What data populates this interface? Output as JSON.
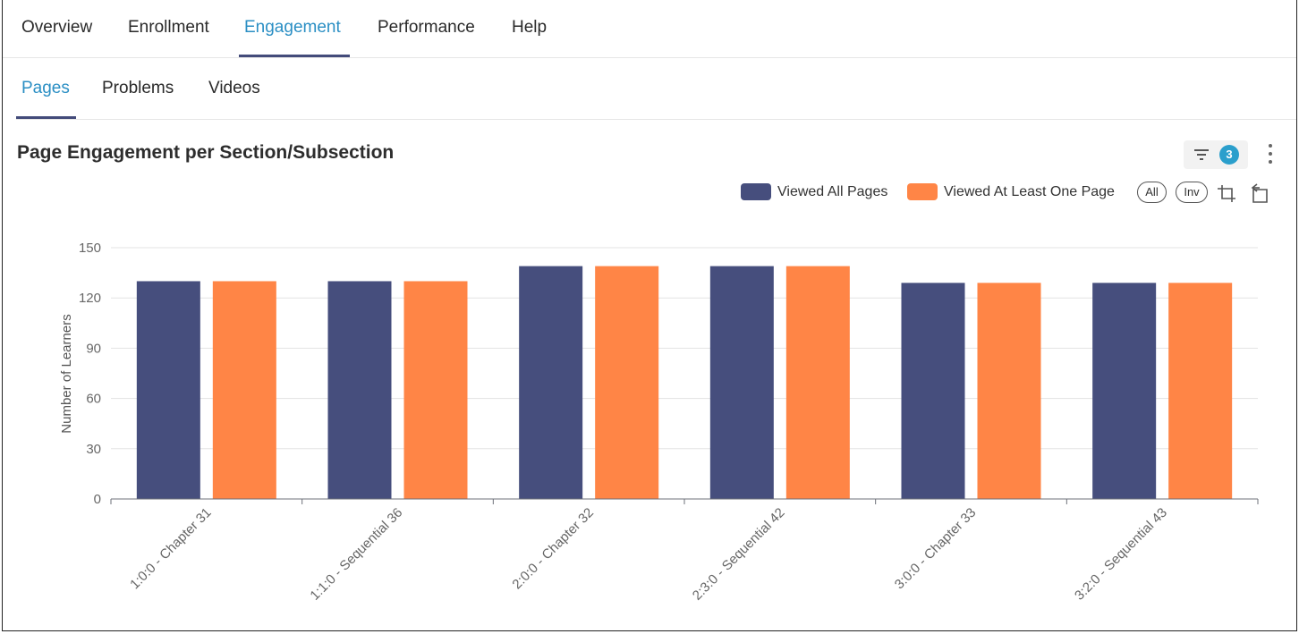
{
  "top_tabs": [
    {
      "label": "Overview"
    },
    {
      "label": "Enrollment"
    },
    {
      "label": "Engagement",
      "active": true
    },
    {
      "label": "Performance"
    },
    {
      "label": "Help"
    }
  ],
  "sub_tabs": [
    {
      "label": "Pages",
      "active": true
    },
    {
      "label": "Problems"
    },
    {
      "label": "Videos"
    }
  ],
  "card": {
    "title": "Page Engagement per Section/Subsection",
    "filter_count": "3",
    "filter_icon": "filter-icon",
    "menu_icon": "kebab-menu-icon"
  },
  "legend_controls": {
    "all_label": "All",
    "inv_label": "Inv",
    "zoom_icon": "data-zoom-icon",
    "reset_icon": "zoom-reset-icon"
  },
  "colors": {
    "accent": "#2b8fc4",
    "series_viewed_all": "#464e7d",
    "series_viewed_one": "#ff8546",
    "badge": "#2b9fcc"
  },
  "chart_data": {
    "type": "bar",
    "categories": [
      "1:0:0 - Chapter 31",
      "1:1:0 - Sequential 36",
      "2:0:0 - Chapter 32",
      "2:3:0 - Sequential 42",
      "3:0:0 - Chapter 33",
      "3:2:0 - Sequential 43"
    ],
    "series": [
      {
        "name": "Viewed All Pages",
        "values": [
          130,
          130,
          139,
          139,
          129,
          129
        ],
        "color": "#464e7d"
      },
      {
        "name": "Viewed At Least One Page",
        "values": [
          130,
          130,
          139,
          139,
          129,
          129
        ],
        "color": "#ff8546"
      }
    ],
    "ylabel": "Number of Learners",
    "xlabel": "",
    "ylim": [
      0,
      150
    ],
    "yticks": [
      "0",
      "30",
      "60",
      "90",
      "120",
      "150"
    ],
    "grid": true,
    "legend_position": "top-right"
  }
}
